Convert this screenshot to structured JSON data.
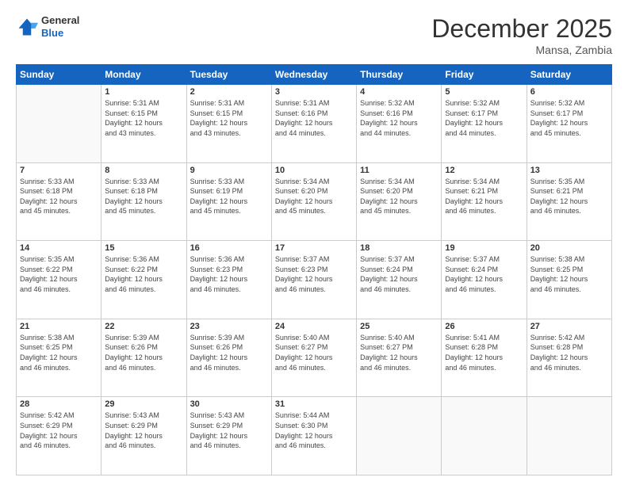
{
  "header": {
    "logo_general": "General",
    "logo_blue": "Blue",
    "month_title": "December 2025",
    "subtitle": "Mansa, Zambia"
  },
  "days_of_week": [
    "Sunday",
    "Monday",
    "Tuesday",
    "Wednesday",
    "Thursday",
    "Friday",
    "Saturday"
  ],
  "weeks": [
    [
      {
        "day": "",
        "info": ""
      },
      {
        "day": "1",
        "info": "Sunrise: 5:31 AM\nSunset: 6:15 PM\nDaylight: 12 hours\nand 43 minutes."
      },
      {
        "day": "2",
        "info": "Sunrise: 5:31 AM\nSunset: 6:15 PM\nDaylight: 12 hours\nand 43 minutes."
      },
      {
        "day": "3",
        "info": "Sunrise: 5:31 AM\nSunset: 6:16 PM\nDaylight: 12 hours\nand 44 minutes."
      },
      {
        "day": "4",
        "info": "Sunrise: 5:32 AM\nSunset: 6:16 PM\nDaylight: 12 hours\nand 44 minutes."
      },
      {
        "day": "5",
        "info": "Sunrise: 5:32 AM\nSunset: 6:17 PM\nDaylight: 12 hours\nand 44 minutes."
      },
      {
        "day": "6",
        "info": "Sunrise: 5:32 AM\nSunset: 6:17 PM\nDaylight: 12 hours\nand 45 minutes."
      }
    ],
    [
      {
        "day": "7",
        "info": "Sunrise: 5:33 AM\nSunset: 6:18 PM\nDaylight: 12 hours\nand 45 minutes."
      },
      {
        "day": "8",
        "info": "Sunrise: 5:33 AM\nSunset: 6:18 PM\nDaylight: 12 hours\nand 45 minutes."
      },
      {
        "day": "9",
        "info": "Sunrise: 5:33 AM\nSunset: 6:19 PM\nDaylight: 12 hours\nand 45 minutes."
      },
      {
        "day": "10",
        "info": "Sunrise: 5:34 AM\nSunset: 6:20 PM\nDaylight: 12 hours\nand 45 minutes."
      },
      {
        "day": "11",
        "info": "Sunrise: 5:34 AM\nSunset: 6:20 PM\nDaylight: 12 hours\nand 45 minutes."
      },
      {
        "day": "12",
        "info": "Sunrise: 5:34 AM\nSunset: 6:21 PM\nDaylight: 12 hours\nand 46 minutes."
      },
      {
        "day": "13",
        "info": "Sunrise: 5:35 AM\nSunset: 6:21 PM\nDaylight: 12 hours\nand 46 minutes."
      }
    ],
    [
      {
        "day": "14",
        "info": "Sunrise: 5:35 AM\nSunset: 6:22 PM\nDaylight: 12 hours\nand 46 minutes."
      },
      {
        "day": "15",
        "info": "Sunrise: 5:36 AM\nSunset: 6:22 PM\nDaylight: 12 hours\nand 46 minutes."
      },
      {
        "day": "16",
        "info": "Sunrise: 5:36 AM\nSunset: 6:23 PM\nDaylight: 12 hours\nand 46 minutes."
      },
      {
        "day": "17",
        "info": "Sunrise: 5:37 AM\nSunset: 6:23 PM\nDaylight: 12 hours\nand 46 minutes."
      },
      {
        "day": "18",
        "info": "Sunrise: 5:37 AM\nSunset: 6:24 PM\nDaylight: 12 hours\nand 46 minutes."
      },
      {
        "day": "19",
        "info": "Sunrise: 5:37 AM\nSunset: 6:24 PM\nDaylight: 12 hours\nand 46 minutes."
      },
      {
        "day": "20",
        "info": "Sunrise: 5:38 AM\nSunset: 6:25 PM\nDaylight: 12 hours\nand 46 minutes."
      }
    ],
    [
      {
        "day": "21",
        "info": "Sunrise: 5:38 AM\nSunset: 6:25 PM\nDaylight: 12 hours\nand 46 minutes."
      },
      {
        "day": "22",
        "info": "Sunrise: 5:39 AM\nSunset: 6:26 PM\nDaylight: 12 hours\nand 46 minutes."
      },
      {
        "day": "23",
        "info": "Sunrise: 5:39 AM\nSunset: 6:26 PM\nDaylight: 12 hours\nand 46 minutes."
      },
      {
        "day": "24",
        "info": "Sunrise: 5:40 AM\nSunset: 6:27 PM\nDaylight: 12 hours\nand 46 minutes."
      },
      {
        "day": "25",
        "info": "Sunrise: 5:40 AM\nSunset: 6:27 PM\nDaylight: 12 hours\nand 46 minutes."
      },
      {
        "day": "26",
        "info": "Sunrise: 5:41 AM\nSunset: 6:28 PM\nDaylight: 12 hours\nand 46 minutes."
      },
      {
        "day": "27",
        "info": "Sunrise: 5:42 AM\nSunset: 6:28 PM\nDaylight: 12 hours\nand 46 minutes."
      }
    ],
    [
      {
        "day": "28",
        "info": "Sunrise: 5:42 AM\nSunset: 6:29 PM\nDaylight: 12 hours\nand 46 minutes."
      },
      {
        "day": "29",
        "info": "Sunrise: 5:43 AM\nSunset: 6:29 PM\nDaylight: 12 hours\nand 46 minutes."
      },
      {
        "day": "30",
        "info": "Sunrise: 5:43 AM\nSunset: 6:29 PM\nDaylight: 12 hours\nand 46 minutes."
      },
      {
        "day": "31",
        "info": "Sunrise: 5:44 AM\nSunset: 6:30 PM\nDaylight: 12 hours\nand 46 minutes."
      },
      {
        "day": "",
        "info": ""
      },
      {
        "day": "",
        "info": ""
      },
      {
        "day": "",
        "info": ""
      }
    ]
  ]
}
